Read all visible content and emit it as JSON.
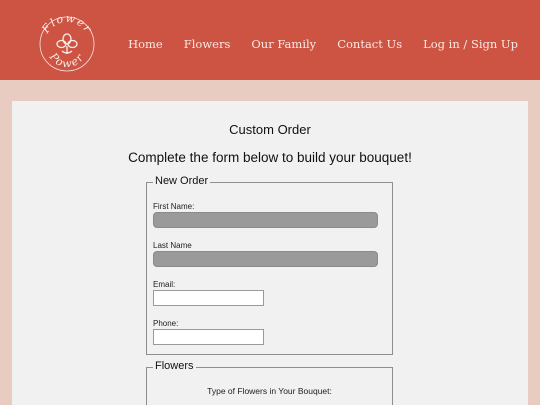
{
  "brand": {
    "logo_text_top": "Flower",
    "logo_text_bottom": "Power",
    "accent_color": "#cd5443"
  },
  "nav": {
    "items": [
      {
        "label": "Home"
      },
      {
        "label": "Flowers"
      },
      {
        "label": "Our Family"
      },
      {
        "label": "Contact Us"
      },
      {
        "label": "Log in / Sign Up"
      }
    ]
  },
  "main": {
    "title": "Custom Order",
    "subtitle": "Complete the form below to build your bouquet!"
  },
  "order_form": {
    "legend": "New Order",
    "first_name_label": "First Name:",
    "last_name_label": "Last Name",
    "email_label": "Email:",
    "phone_label": "Phone:",
    "first_name_value": "",
    "last_name_value": "",
    "email_value": "",
    "phone_value": ""
  },
  "flowers_section": {
    "legend": "Flowers",
    "prompt": "Type of Flowers in Your Bouquet:"
  }
}
